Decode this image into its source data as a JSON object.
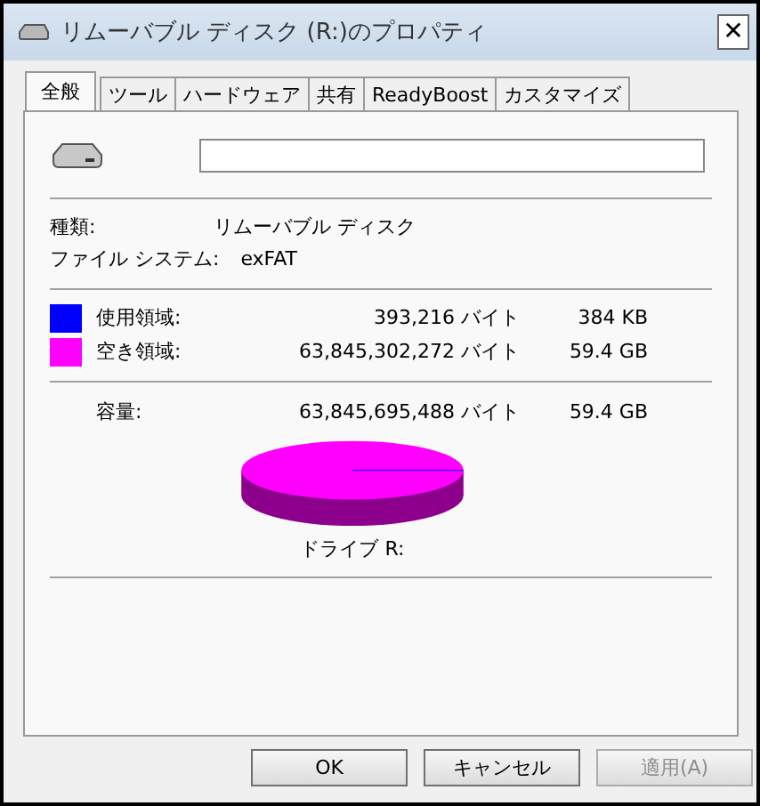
{
  "window": {
    "title": "リムーバブル ディスク (R:)のプロパティ",
    "close": "✕"
  },
  "tabs": [
    {
      "label": "全般",
      "selected": true
    },
    {
      "label": "ツール",
      "selected": false
    },
    {
      "label": "ハードウェア",
      "selected": false
    },
    {
      "label": "共有",
      "selected": false
    },
    {
      "label": "ReadyBoost",
      "selected": false
    },
    {
      "label": "カスタマイズ",
      "selected": false
    }
  ],
  "info": [
    {
      "label": "種類:",
      "value": "リムーバブル ディスク"
    },
    {
      "label": "ファイル システム:",
      "value": "exFAT"
    }
  ],
  "space": [
    {
      "label": "使用領域:",
      "bytes": "393,216 バイト",
      "size": "384 KB",
      "color": "#0000ff"
    },
    {
      "label": "空き領域:",
      "bytes": "63,845,302,272 バイト",
      "size": "59.4 GB",
      "color": "#ff00ff"
    }
  ],
  "capacity": {
    "label": "容量:",
    "bytes": "63,845,695,488 バイト",
    "size": "59.4 GB"
  },
  "drive_label": "ドライブ R:",
  "buttons": [
    {
      "label": "OK",
      "disabled": false
    },
    {
      "label": "キャンセル",
      "disabled": false
    },
    {
      "label": "適用(A)",
      "disabled": true
    }
  ]
}
